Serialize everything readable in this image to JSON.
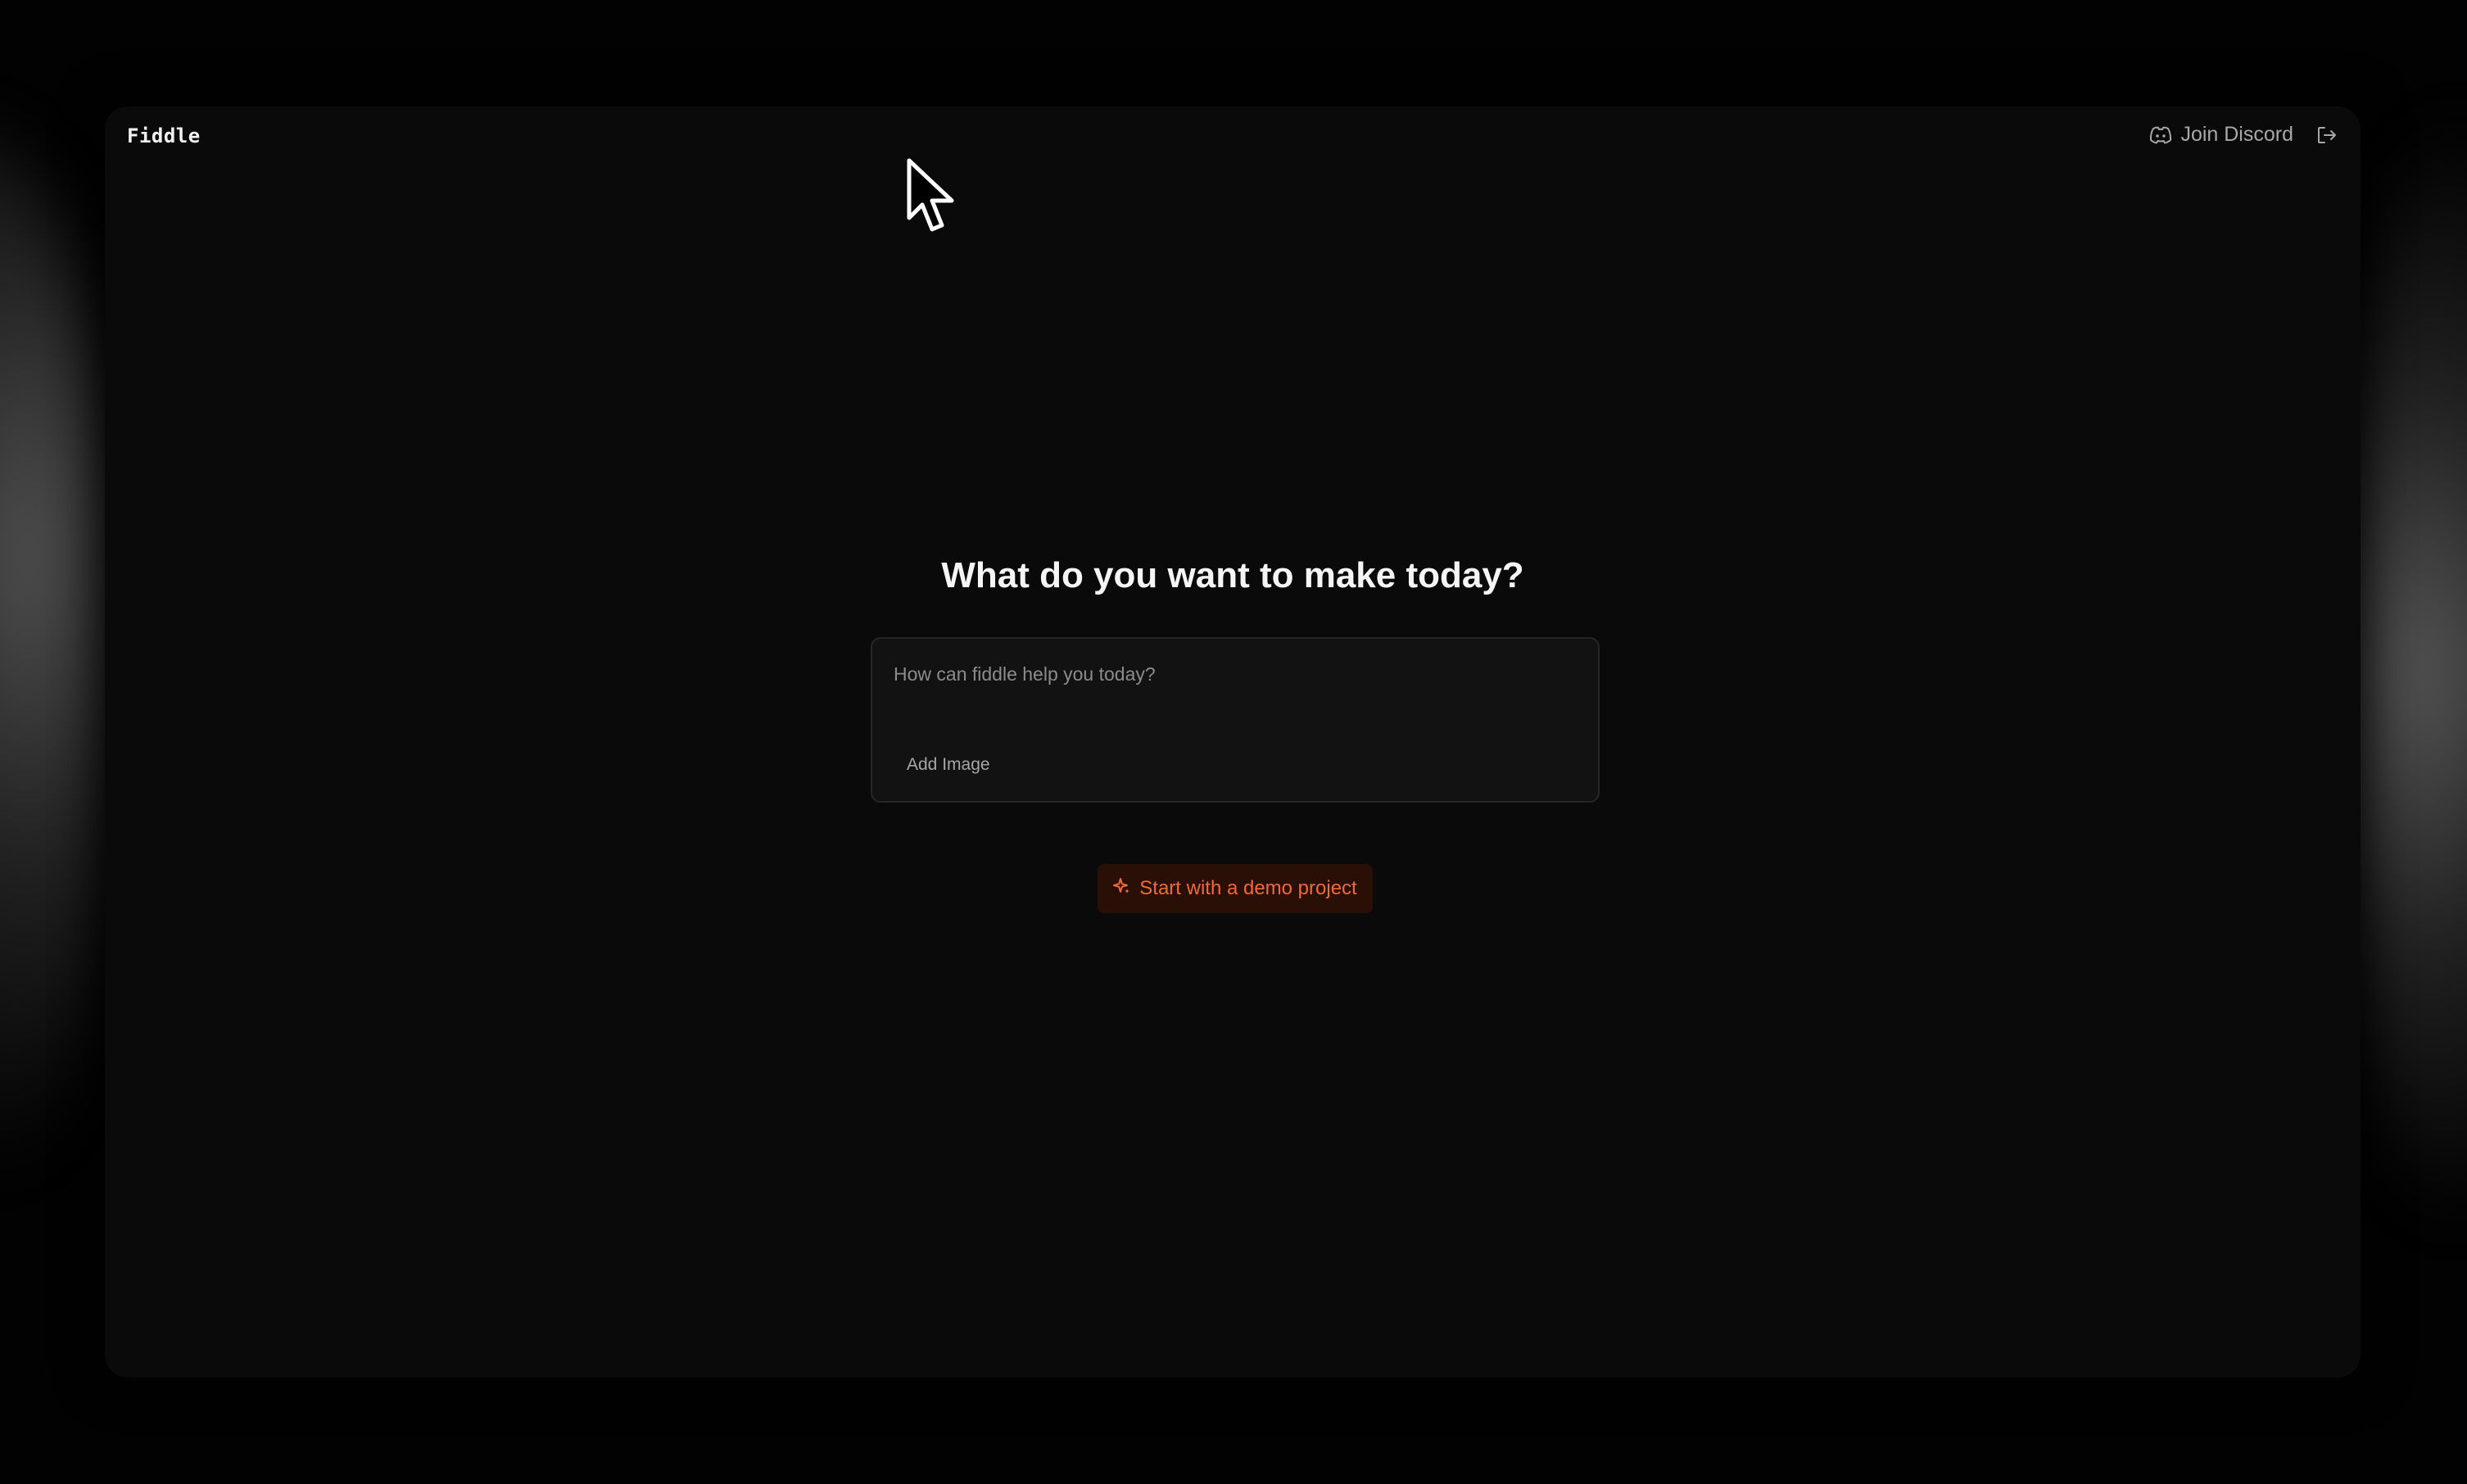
{
  "app": {
    "brand": "Fiddle"
  },
  "header": {
    "discord_label": "Join Discord",
    "icons": {
      "discord": "discord-icon",
      "logout": "logout-icon"
    }
  },
  "main": {
    "headline": "What do you want to make today?",
    "prompt": {
      "placeholder": "How can fiddle help you today?",
      "value": "",
      "add_image_label": "Add Image"
    },
    "demo_button": {
      "label": "Start with a demo project",
      "icon": "sparkle-icon"
    }
  },
  "colors": {
    "background": "#0a0a0a",
    "accent": "#ef6a36",
    "accent_bg": "#2a0f07",
    "input_bg": "#121212",
    "text_primary": "#f5f5f5",
    "text_muted": "#a8a8a8"
  }
}
